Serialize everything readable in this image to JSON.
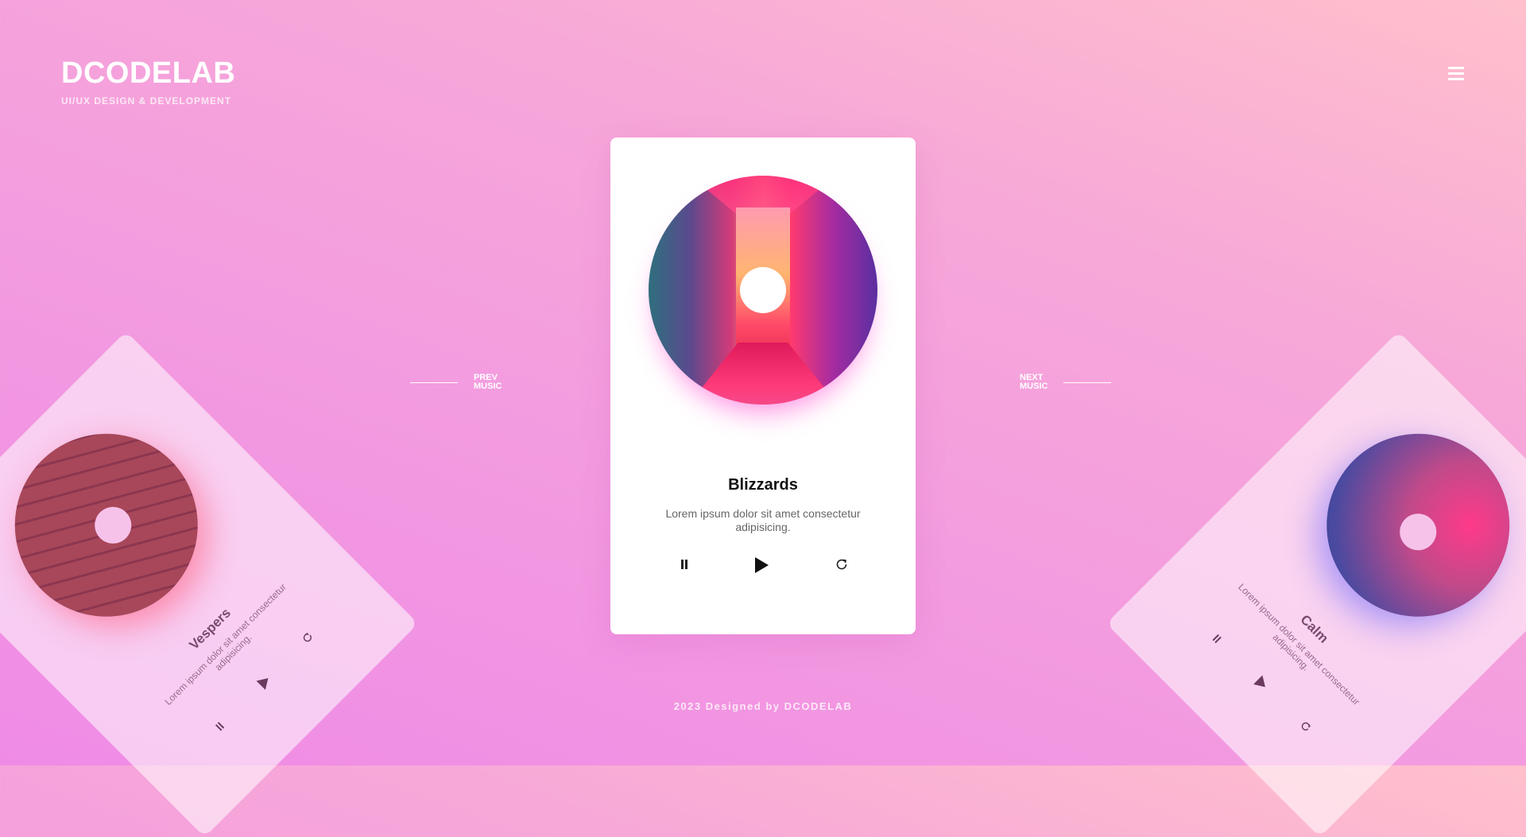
{
  "brand": {
    "title": "DCODELAB",
    "subtitle": "UI/UX DESIGN & DEVELOPMENT"
  },
  "menu": {
    "icon": "hamburger-menu-icon"
  },
  "nav": {
    "prev_label_line1": "PREV",
    "prev_label_line2": "MUSIC",
    "next_label_line1": "NEXT",
    "next_label_line2": "MUSIC"
  },
  "cards": {
    "center": {
      "title": "Blizzards",
      "description": "Lorem ipsum dolor sit amet consectetur adipisicing."
    },
    "left": {
      "title": "Vespers",
      "description": "Lorem ipsum dolor sit amet consectetur adipisicing."
    },
    "right": {
      "title": "Calm",
      "description": "Lorem ipsum dolor sit amet consectetur adipisicing."
    }
  },
  "controls": {
    "pause_icon": "pause-icon",
    "play_icon": "play-icon",
    "refresh_icon": "refresh-icon"
  },
  "footer": {
    "text": "2023 Designed by DCODELAB"
  },
  "colors": {
    "background_top": "#ffc0cc",
    "background_bottom": "#ef8be6",
    "card": "#ffffff",
    "title": "#111111"
  }
}
